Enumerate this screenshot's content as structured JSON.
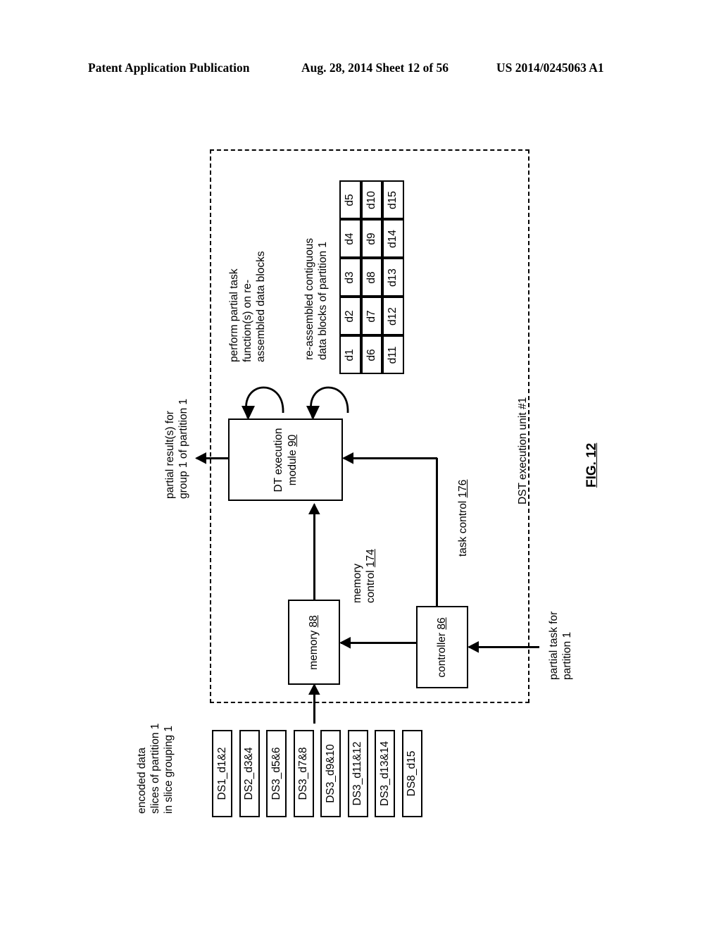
{
  "header": {
    "publication": "Patent Application Publication",
    "date_sheet": "Aug. 28, 2014  Sheet 12 of 56",
    "patent_number": "US 2014/0245063 A1"
  },
  "figure": {
    "label": "FIG. 12",
    "enclosure_label": "DST execution unit #1"
  },
  "annotations": {
    "perform_task": "perform partial task\nfunction(s) on re-\nassembled data blocks",
    "reassembled": "re-assembled contiguous\ndata blocks of partition 1",
    "partial_results": "partial result(s) for\ngroup 1 of partition 1",
    "memory_control": "memory\ncontrol 174",
    "memory_control_ref": "174",
    "task_control": "task control 176",
    "task_control_ref": "176",
    "partial_task_in": "partial task for\npartition 1",
    "encoded_slices": "encoded data\nslices of partition 1\nin slice grouping 1"
  },
  "blocks": [
    {
      "id": "dt-execution-module",
      "name": "DT execution\nmodule ",
      "ref": "90"
    },
    {
      "id": "memory",
      "name": "memory ",
      "ref": "88"
    },
    {
      "id": "controller",
      "name": "controller ",
      "ref": "86"
    }
  ],
  "chart_data": {
    "type": "table",
    "title": "re-assembled contiguous data blocks of partition 1",
    "rows": [
      [
        "d1",
        "d2",
        "d3",
        "d4",
        "d5"
      ],
      [
        "d6",
        "d7",
        "d8",
        "d9",
        "d10"
      ],
      [
        "d11",
        "d12",
        "d13",
        "d14",
        "d15"
      ]
    ]
  },
  "slices": [
    "DS1_d1&2",
    "DS2_d3&4",
    "DS3_d5&6",
    "DS3_d7&8",
    "DS3_d9&10",
    "DS3_d11&12",
    "DS3_d13&14",
    "DS8_d15"
  ]
}
